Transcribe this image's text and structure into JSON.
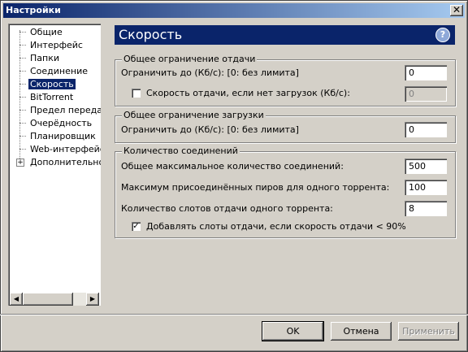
{
  "window": {
    "title": "Настройки",
    "close_label": "✕"
  },
  "sidebar": {
    "items": [
      {
        "label": "Общие"
      },
      {
        "label": "Интерфейс"
      },
      {
        "label": "Папки"
      },
      {
        "label": "Соединение"
      },
      {
        "label": "Скорость",
        "selected": true
      },
      {
        "label": "BitTorrent"
      },
      {
        "label": "Предел передачи"
      },
      {
        "label": "Очерёдность"
      },
      {
        "label": "Планировщик"
      },
      {
        "label": "Web-интерфейс"
      },
      {
        "label": "Дополнительно",
        "expandable": true
      }
    ],
    "expander_symbol": "+",
    "scroll_left": "◀",
    "scroll_right": "▶"
  },
  "page": {
    "title": "Скорость",
    "help_symbol": "?"
  },
  "upload_group": {
    "legend": "Общее ограничение отдачи",
    "limit_label": "Ограничить до (Кб/с): [0: без лимита]",
    "limit_value": "0",
    "no_download_label": "Скорость отдачи, если нет загрузок (Кб/с):",
    "no_download_checked": false,
    "no_download_value": "0"
  },
  "download_group": {
    "legend": "Общее ограничение загрузки",
    "limit_label": "Ограничить до (Кб/с): [0: без лимита]",
    "limit_value": "0"
  },
  "connections_group": {
    "legend": "Количество соединений",
    "max_conn_label": "Общее максимальное количество соединений:",
    "max_conn_value": "500",
    "max_peers_label": "Максимум присоединённых пиров для одного торрента:",
    "max_peers_value": "100",
    "slots_label": "Количество слотов отдачи одного торрента:",
    "slots_value": "8",
    "extra_slots_label": "Добавлять слоты отдачи, если скорость отдачи < 90%",
    "extra_slots_checked": true,
    "check_mark": "✓"
  },
  "buttons": {
    "ok": "OK",
    "cancel": "Отмена",
    "apply": "Применить"
  }
}
